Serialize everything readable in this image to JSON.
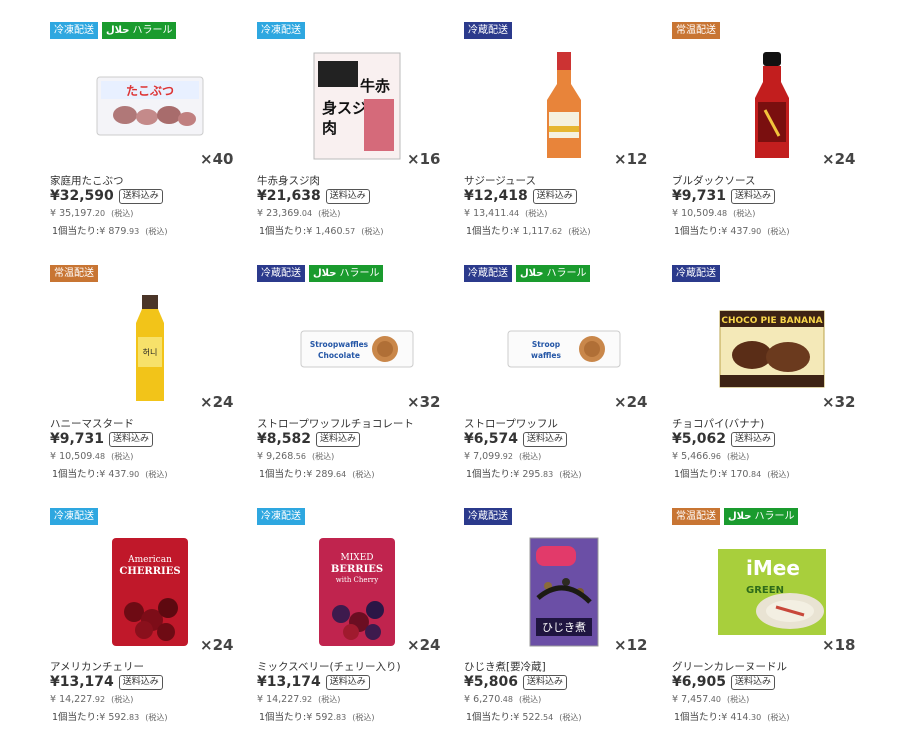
{
  "products": [
    {
      "badges": [
        {
          "type": "frozen",
          "label": "冷凍配送"
        },
        {
          "type": "halal",
          "label": "ハラール",
          "mark": "حلال"
        }
      ],
      "icon": "octopus-package",
      "name": "家庭用たこぶつ",
      "qty": "×40",
      "price": "¥32,590",
      "shipping": "送料込み",
      "tax_main": "¥ 35,197",
      "tax_dec": ".20",
      "tax_label": "(税込)",
      "unit_label": "1個当たり:",
      "unit_main": "¥ 879",
      "unit_dec": ".93",
      "unit_tax": "(税込)",
      "pkg_text": "たこぶつ"
    },
    {
      "badges": [
        {
          "type": "frozen",
          "label": "冷凍配送"
        }
      ],
      "icon": "beef-tendon-package",
      "name": "牛赤身スジ肉",
      "qty": "×16",
      "price": "¥21,638",
      "shipping": "送料込み",
      "tax_main": "¥ 23,369",
      "tax_dec": ".04",
      "tax_label": "(税込)",
      "unit_label": "1個当たり:",
      "unit_main": "¥ 1,460",
      "unit_dec": ".57",
      "unit_tax": "(税込)",
      "pkg_text": "牛赤身スジ肉"
    },
    {
      "badges": [
        {
          "type": "chilled",
          "label": "冷蔵配送"
        }
      ],
      "icon": "juice-bottle",
      "name": "サジージュース",
      "qty": "×12",
      "price": "¥12,418",
      "shipping": "送料込み",
      "tax_main": "¥ 13,411",
      "tax_dec": ".44",
      "tax_label": "(税込)",
      "unit_label": "1個当たり:",
      "unit_main": "¥ 1,117",
      "unit_dec": ".62",
      "unit_tax": "(税込)",
      "pkg_text": ""
    },
    {
      "badges": [
        {
          "type": "ambient",
          "label": "常温配送"
        }
      ],
      "icon": "sauce-bottle",
      "name": "ブルダックソース",
      "qty": "×24",
      "price": "¥9,731",
      "shipping": "送料込み",
      "tax_main": "¥ 10,509",
      "tax_dec": ".48",
      "tax_label": "(税込)",
      "unit_label": "1個当たり:",
      "unit_main": "¥ 437",
      "unit_dec": ".90",
      "unit_tax": "(税込)",
      "pkg_text": ""
    },
    {
      "badges": [
        {
          "type": "ambient",
          "label": "常温配送"
        }
      ],
      "icon": "mustard-bottle",
      "name": "ハニーマスタード",
      "qty": "×24",
      "price": "¥9,731",
      "shipping": "送料込み",
      "tax_main": "¥ 10,509",
      "tax_dec": ".48",
      "tax_label": "(税込)",
      "unit_label": "1個当たり:",
      "unit_main": "¥ 437",
      "unit_dec": ".90",
      "unit_tax": "(税込)",
      "pkg_text": ""
    },
    {
      "badges": [
        {
          "type": "chilled",
          "label": "冷蔵配送"
        },
        {
          "type": "halal",
          "label": "ハラール",
          "mark": "حلال"
        }
      ],
      "icon": "waffle-package",
      "name": "ストロープワッフルチョコレート",
      "qty": "×32",
      "price": "¥8,582",
      "shipping": "送料込み",
      "tax_main": "¥ 9,268",
      "tax_dec": ".56",
      "tax_label": "(税込)",
      "unit_label": "1個当たり:",
      "unit_main": "¥ 289",
      "unit_dec": ".64",
      "unit_tax": "(税込)",
      "pkg_text": "Stroopwaffles Chocolate"
    },
    {
      "badges": [
        {
          "type": "chilled",
          "label": "冷蔵配送"
        },
        {
          "type": "halal",
          "label": "ハラール",
          "mark": "حلال"
        }
      ],
      "icon": "waffle-package",
      "name": "ストロープワッフル",
      "qty": "×24",
      "price": "¥6,574",
      "shipping": "送料込み",
      "tax_main": "¥ 7,099",
      "tax_dec": ".92",
      "tax_label": "(税込)",
      "unit_label": "1個当たり:",
      "unit_main": "¥ 295",
      "unit_dec": ".83",
      "unit_tax": "(税込)",
      "pkg_text": "Stroop waffles"
    },
    {
      "badges": [
        {
          "type": "chilled",
          "label": "冷蔵配送"
        }
      ],
      "icon": "chocopie-box",
      "name": "チョコパイ(バナナ)",
      "qty": "×32",
      "price": "¥5,062",
      "shipping": "送料込み",
      "tax_main": "¥ 5,466",
      "tax_dec": ".96",
      "tax_label": "(税込)",
      "unit_label": "1個当たり:",
      "unit_main": "¥ 170",
      "unit_dec": ".84",
      "unit_tax": "(税込)",
      "pkg_text": "CHOCO PIE BANANA"
    },
    {
      "badges": [
        {
          "type": "frozen",
          "label": "冷凍配送"
        }
      ],
      "icon": "cherry-bag",
      "name": "アメリカンチェリー",
      "qty": "×24",
      "price": "¥13,174",
      "shipping": "送料込み",
      "tax_main": "¥ 14,227",
      "tax_dec": ".92",
      "tax_label": "(税込)",
      "unit_label": "1個当たり:",
      "unit_main": "¥ 592",
      "unit_dec": ".83",
      "unit_tax": "(税込)",
      "pkg_text": "American CHERRIES"
    },
    {
      "badges": [
        {
          "type": "frozen",
          "label": "冷凍配送"
        }
      ],
      "icon": "berries-bag",
      "name": "ミックスベリー(チェリー入り)",
      "qty": "×24",
      "price": "¥13,174",
      "shipping": "送料込み",
      "tax_main": "¥ 14,227",
      "tax_dec": ".92",
      "tax_label": "(税込)",
      "unit_label": "1個当たり:",
      "unit_main": "¥ 592",
      "unit_dec": ".83",
      "unit_tax": "(税込)",
      "pkg_text": "MIXED BERRIES with Cherry"
    },
    {
      "badges": [
        {
          "type": "chilled",
          "label": "冷蔵配送"
        }
      ],
      "icon": "hijiki-pack",
      "name": "ひじき煮[要冷蔵]",
      "qty": "×12",
      "price": "¥5,806",
      "shipping": "送料込み",
      "tax_main": "¥ 6,270",
      "tax_dec": ".48",
      "tax_label": "(税込)",
      "unit_label": "1個当たり:",
      "unit_main": "¥ 522",
      "unit_dec": ".54",
      "unit_tax": "(税込)",
      "pkg_text": "ひじき煮"
    },
    {
      "badges": [
        {
          "type": "ambient",
          "label": "常温配送"
        },
        {
          "type": "halal",
          "label": "ハラール",
          "mark": "حلال"
        }
      ],
      "icon": "noodle-package",
      "name": "グリーンカレーヌードル",
      "qty": "×18",
      "price": "¥6,905",
      "shipping": "送料込み",
      "tax_main": "¥ 7,457",
      "tax_dec": ".40",
      "tax_label": "(税込)",
      "unit_label": "1個当たり:",
      "unit_main": "¥ 414",
      "unit_dec": ".30",
      "unit_tax": "(税込)",
      "pkg_text": "iMee GREEN"
    }
  ]
}
